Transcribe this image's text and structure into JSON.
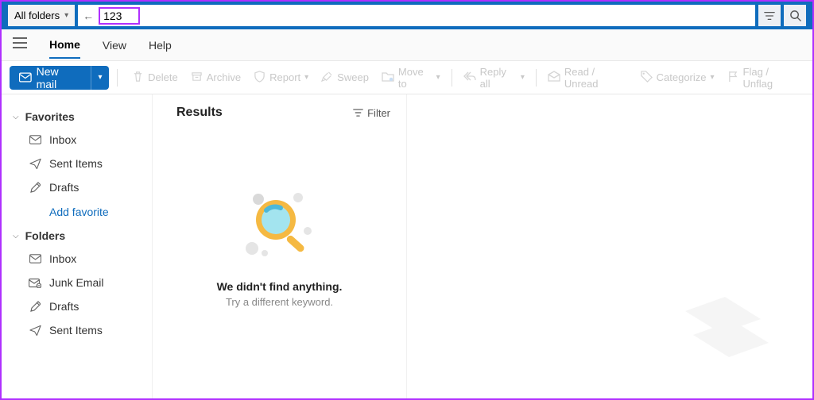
{
  "searchbar": {
    "scope": "All folders",
    "query": "123"
  },
  "menubar": {
    "tabs": [
      "Home",
      "View",
      "Help"
    ],
    "active": 0
  },
  "toolbar": {
    "newmail": "New mail",
    "items": [
      {
        "icon": "trash",
        "label": "Delete"
      },
      {
        "icon": "archive",
        "label": "Archive"
      },
      {
        "icon": "shield",
        "label": "Report",
        "dropdown": true
      },
      {
        "icon": "broom",
        "label": "Sweep"
      },
      {
        "icon": "folder-move",
        "label": "Move to",
        "dropdown": true
      },
      {
        "sep": true
      },
      {
        "icon": "reply-all",
        "label": "Reply all",
        "dropdown": true
      },
      {
        "sep": true
      },
      {
        "icon": "mail-read",
        "label": "Read / Unread"
      },
      {
        "icon": "tag",
        "label": "Categorize",
        "dropdown": true
      },
      {
        "icon": "flag",
        "label": "Flag / Unflag"
      }
    ]
  },
  "sidebar": {
    "sections": [
      {
        "label": "Favorites",
        "items": [
          {
            "icon": "inbox",
            "label": "Inbox"
          },
          {
            "icon": "sent",
            "label": "Sent Items"
          },
          {
            "icon": "draft",
            "label": "Drafts"
          }
        ],
        "add": "Add favorite"
      },
      {
        "label": "Folders",
        "items": [
          {
            "icon": "inbox",
            "label": "Inbox"
          },
          {
            "icon": "junk",
            "label": "Junk Email"
          },
          {
            "icon": "draft",
            "label": "Drafts"
          },
          {
            "icon": "sent",
            "label": "Sent Items"
          }
        ]
      }
    ]
  },
  "results": {
    "title": "Results",
    "filter": "Filter",
    "empty_heading": "We didn't find anything.",
    "empty_sub": "Try a different keyword."
  }
}
